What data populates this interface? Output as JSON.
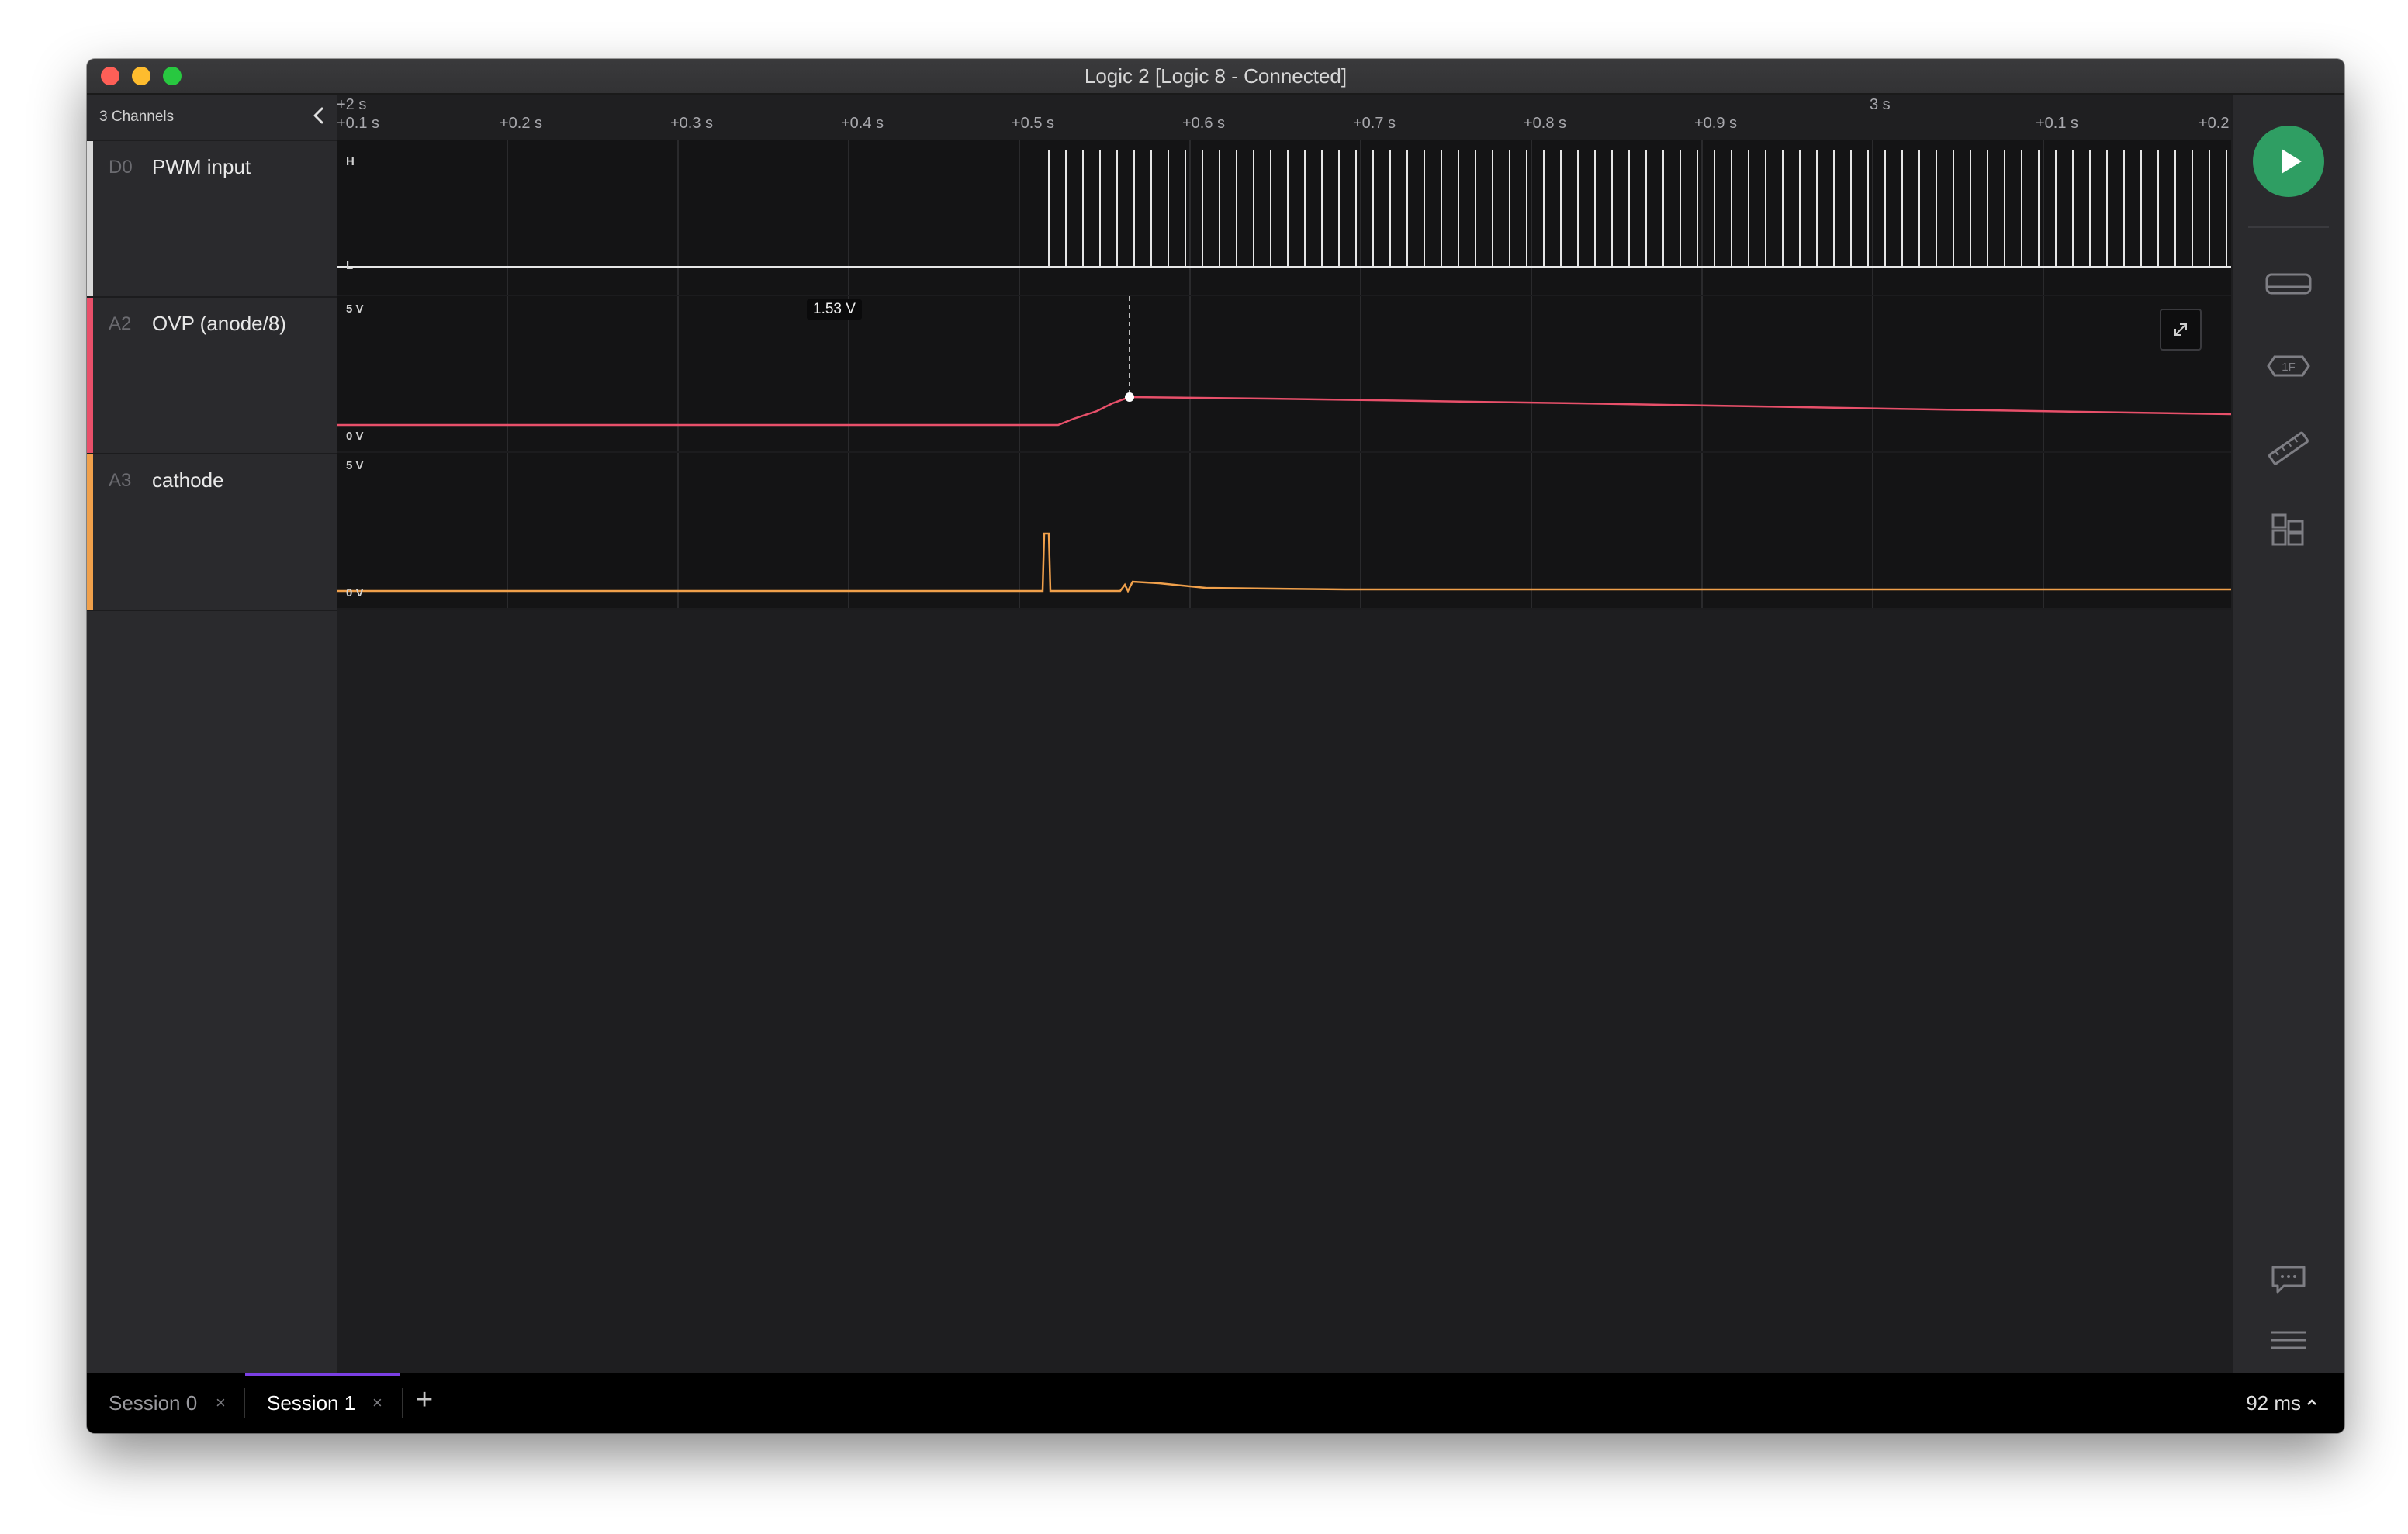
{
  "window": {
    "title": "Logic 2 [Logic 8 - Connected]"
  },
  "sidebar": {
    "channels_count": "3 Channels",
    "channels": [
      {
        "id": "D0",
        "name": "PWM input",
        "color": "#d9d9d9",
        "type": "digital"
      },
      {
        "id": "A2",
        "name": "OVP (anode/8)",
        "color": "#e8506a",
        "type": "analog"
      },
      {
        "id": "A3",
        "name": "cathode",
        "color": "#f0a04b",
        "type": "analog"
      }
    ]
  },
  "timeline": {
    "major_left": "+2 s",
    "major_right": "3 s",
    "ticks": [
      "+0.1 s",
      "+0.2 s",
      "+0.3 s",
      "+0.4 s",
      "+0.5 s",
      "+0.6 s",
      "+0.7 s",
      "+0.8 s",
      "+0.9 s",
      "+0.1 s",
      "+0.2"
    ]
  },
  "plots": {
    "digital_high": "H",
    "digital_low": "L",
    "ovp_top": "5 V",
    "ovp_bottom": "0 V",
    "cathode_top": "5 V",
    "cathode_bottom": "0 V",
    "tooltip_value": "1.53 V"
  },
  "rightbar": {
    "icons": [
      "play-icon",
      "device-icon",
      "analyzer-icon",
      "measure-icon",
      "extensions-icon",
      "feedback-icon",
      "menu-icon"
    ]
  },
  "bottombar": {
    "tabs": [
      {
        "label": "Session 0",
        "close": "×",
        "active": false
      },
      {
        "label": "Session 1",
        "close": "×",
        "active": true
      }
    ],
    "add_tab": "+",
    "latency": "92 ms"
  }
}
